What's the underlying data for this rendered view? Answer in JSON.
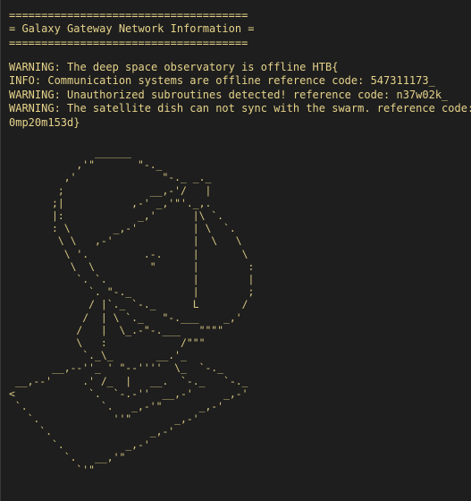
{
  "header": {
    "border_top": "=====================================",
    "title": "= Galaxy Gateway Network Information =",
    "border_bottom": "====================================="
  },
  "messages": [
    "WARNING: The deep space observatory is offline HTB{",
    "INFO: Communication systems are offline reference code: 547311173_",
    "WARNING: Unauthorized subroutines detected! reference code: n37w02k_",
    "WARNING: The satellite dish can not sync with the swarm. reference code: c"
  ],
  "message_wrap": "0mp20m153d}",
  "satellite_dish_ascii": "              ______\n           ,'\"       \"-._\n         ,'              \"-._ _._\n        ;              __,-'/   |\n       ;|           ,-' _,'\"'._,.\n       |:            _,'      |\\ `.\n       : \\       _,-'         | \\  `.\n        \\ \\   ,-'             |  \\   \\\n         \\ '.         .-.     |       \\\n          \\  \\         \"      |        :\n           `. `.              |        |\n             `. \"-._          |        ;\n             / |`._ `-._      L       /\n            /  | \\ `._   \"-.___    _,'\n           /   |  \\_.-\"-.___   \"\"\"\"\n           \\   :            /\"\"\"\n            `._\\_       __.'_\n       __,--''_ ' \"--''''  \\_  `-._\n __,--'     .' /_  |   __.  `-._   `-._\n<            `.  `-.-''  __,-'     _,-'\n `.            `.   _,-'\"      _,-'\n   `.            ''\"       _,-'\n     `.                _,-'\n       `.          _,-'\n         `.   __,'\"\n           `'\""
}
